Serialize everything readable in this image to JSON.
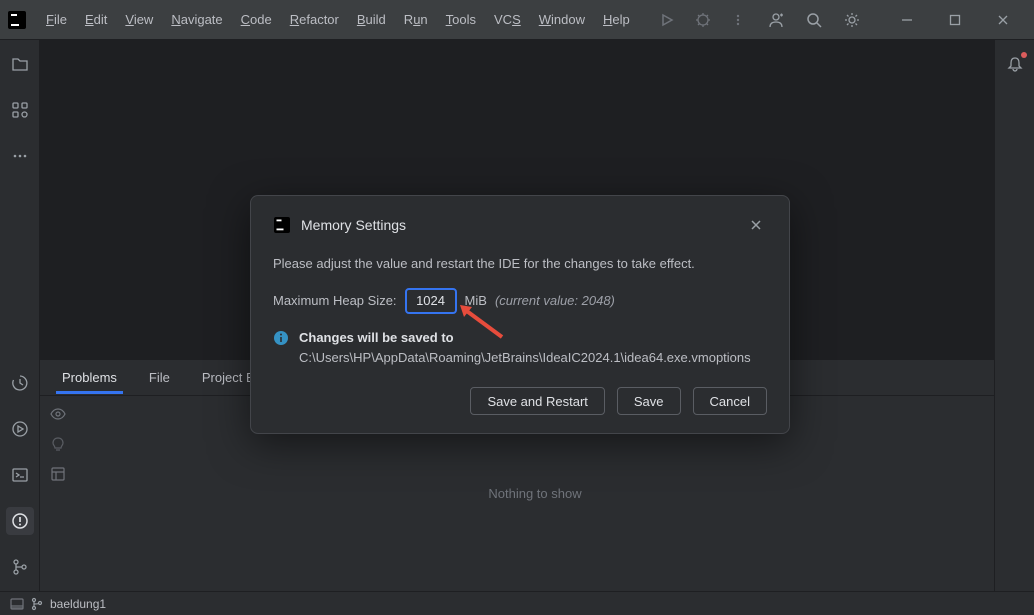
{
  "menu": {
    "file": "File",
    "edit": "Edit",
    "view": "View",
    "navigate": "Navigate",
    "code": "Code",
    "refactor": "Refactor",
    "build": "Build",
    "run": "Run",
    "tools": "Tools",
    "vcs": "VCS",
    "window": "Window",
    "help": "Help"
  },
  "panel": {
    "tabs": {
      "problems": "Problems",
      "file": "File",
      "project_errors": "Project Errors"
    },
    "empty": "Nothing to show"
  },
  "status": {
    "branch": "baeldung1"
  },
  "dialog": {
    "title": "Memory Settings",
    "message": "Please adjust the value and restart the IDE for the changes to take effect.",
    "heap_label": "Maximum Heap Size:",
    "heap_value": "1024",
    "mib": "MiB",
    "current_value": "(current value: 2048)",
    "info_bold": "Changes will be saved to",
    "info_path": "C:\\Users\\HP\\AppData\\Roaming\\JetBrains\\IdeaIC2024.1\\idea64.exe.vmoptions",
    "buttons": {
      "save_restart": "Save and Restart",
      "save": "Save",
      "cancel": "Cancel"
    }
  }
}
